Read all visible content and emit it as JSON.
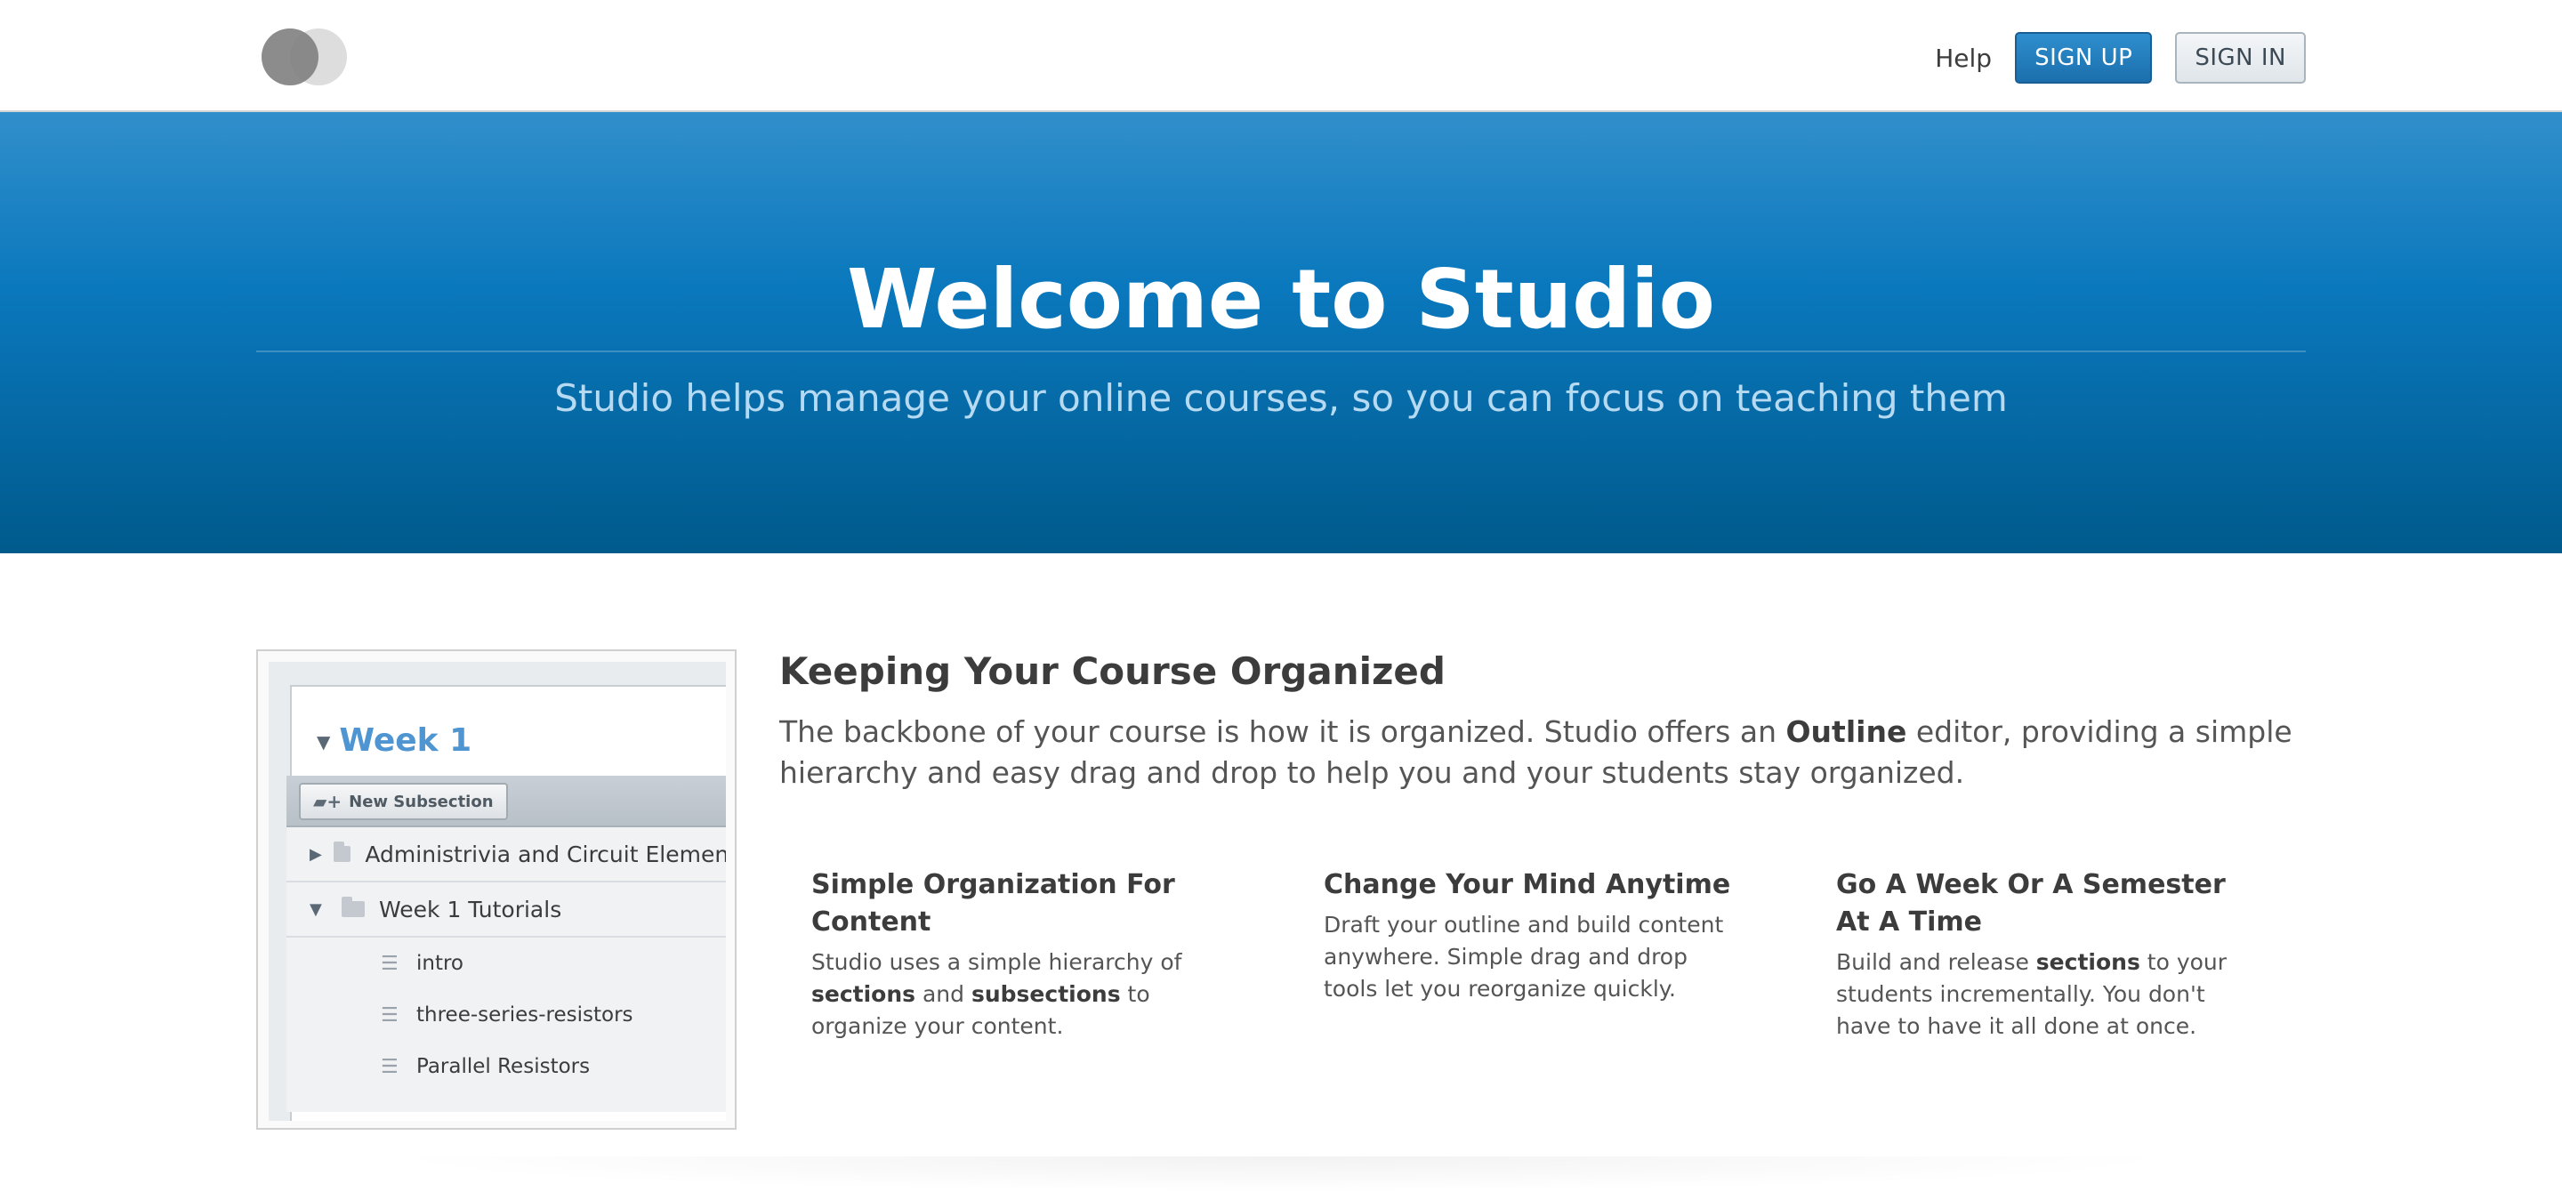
{
  "header": {
    "help_label": "Help",
    "signup_label": "SIGN UP",
    "signin_label": "SIGN IN"
  },
  "hero": {
    "title": "Welcome to Studio",
    "subtitle": "Studio helps manage your online courses, so you can focus on teaching them"
  },
  "preview": {
    "week_title": "Week 1",
    "new_subsection_label": "New Subsection",
    "items": [
      "Administrivia and Circuit Elements",
      "Week 1 Tutorials"
    ],
    "subitems": [
      "intro",
      "three-series-resistors",
      "Parallel Resistors"
    ]
  },
  "main": {
    "title": "Keeping Your Course Organized",
    "desc_pre": "The backbone of your course is how it is organized. Studio offers an ",
    "desc_bold": "Outline",
    "desc_post": " editor, providing a simple hierarchy and easy drag and drop to help you and your students stay organized."
  },
  "features": [
    {
      "title": "Simple Organization For Content",
      "p1": "Studio uses a simple hierarchy of ",
      "b1": "sections",
      "p2": " and ",
      "b2": "subsections",
      "p3": " to organize your content."
    },
    {
      "title": "Change Your Mind Anytime",
      "text": "Draft your outline and build content anywhere. Simple drag and drop tools let you reorganize quickly."
    },
    {
      "title": "Go A Week Or A Semester At A Time",
      "p1": "Build and release ",
      "b1": "sections",
      "p2": " to your students incrementally. You don't have to have it all done at once."
    }
  ],
  "colors": {
    "primary_blue": "#0a78bd",
    "link_blue": "#4f95d1"
  }
}
